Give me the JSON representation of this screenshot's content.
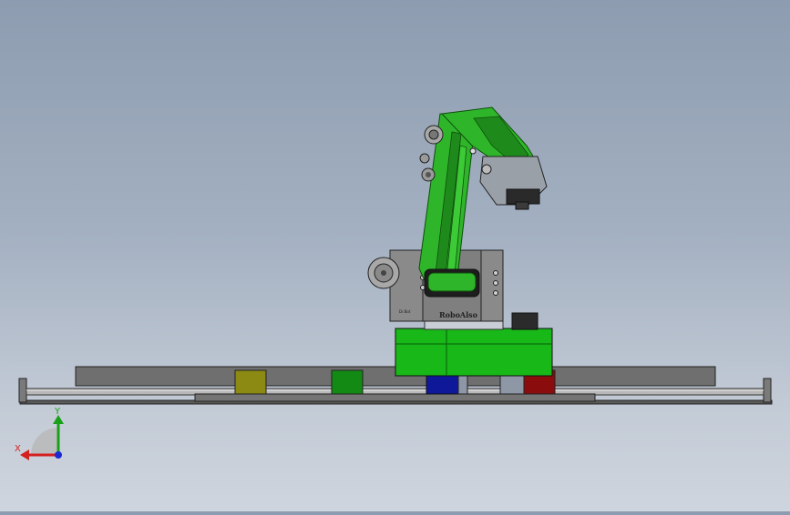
{
  "viewport": {
    "background_top": "#8d9cb0",
    "background_bottom": "#cfd5de"
  },
  "model": {
    "base_engraving": "RoboAlso",
    "base_small_text": "Dr.Bot",
    "arm_color": "#2fb52a",
    "arm_dark": "#1f8a1c",
    "metal_color": "#8a8a8a",
    "block_colors": {
      "yellow": "#8c8a12",
      "green": "#138a13",
      "blue": "#10189a",
      "red": "#8a0c0c"
    }
  },
  "triad": {
    "x_label": "X",
    "y_label": "Y",
    "x_color": "#d42020",
    "y_color": "#18a018"
  }
}
